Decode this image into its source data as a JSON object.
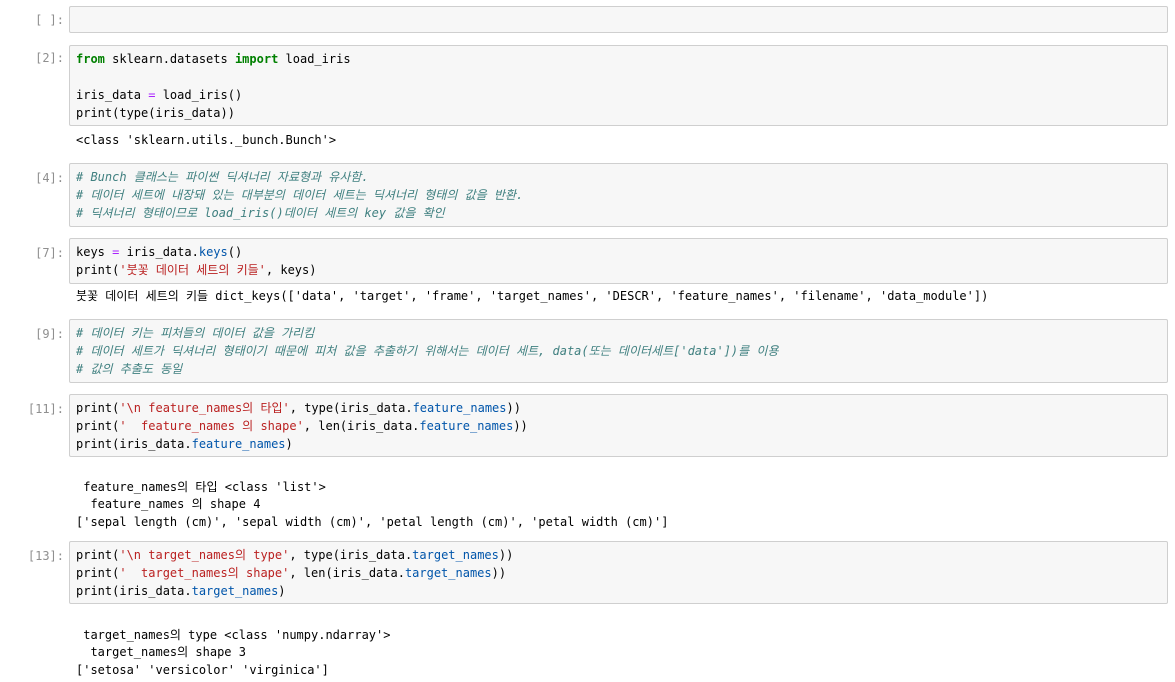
{
  "cells": [
    {
      "prompt": "[ ]:",
      "lines": []
    },
    {
      "prompt": "[2]:",
      "lines": [
        [
          "from",
          " sklearn.datasets ",
          "import",
          " load_iris"
        ],
        [],
        [
          "iris_data ",
          "=",
          " load_iris()"
        ],
        [
          "print(type(iris_data))"
        ]
      ],
      "output": [
        "<class 'sklearn.utils._bunch.Bunch'>"
      ]
    },
    {
      "prompt": "[4]:",
      "lines": [
        [
          "# Bunch 클래스는 파이썬 딕셔너리 자료형과 유사함."
        ],
        [
          "# 데이터 세트에 내장돼 있는 대부분의 데이터 세트는 딕셔너리 형태의 값을 반환."
        ],
        [
          "# 딕셔너리 형태이므로 load_iris()데이터 세트의 key 값을 확인"
        ]
      ]
    },
    {
      "prompt": "[7]:",
      "lines": [
        [
          "keys ",
          "=",
          " iris_data.",
          "keys",
          "()"
        ],
        [
          "print(",
          "'붓꽃 데이터 세트의 키들'",
          ", keys)"
        ]
      ],
      "output": [
        "붓꽃 데이터 세트의 키들 dict_keys(['data', 'target', 'frame', 'target_names', 'DESCR', 'feature_names', 'filename', 'data_module'])"
      ]
    },
    {
      "prompt": "[9]:",
      "lines": [
        [
          "# 데이터 키는 피처들의 데이터 값을 가리킴"
        ],
        [
          "# 데이터 세트가 딕셔너리 형태이기 때문에 피처 값을 추출하기 위해서는 데이터 세트, data(또는 데이터세트['data'])를 이용"
        ],
        [
          "# 값의 추출도 동일"
        ]
      ]
    },
    {
      "prompt": "[11]:",
      "lines": [
        [
          "print(",
          "'\\n feature_names의 타입'",
          ", type(iris_data.",
          "feature_names",
          "))"
        ],
        [
          "print(",
          "'  feature_names 의 shape'",
          ", len(iris_data.",
          "feature_names",
          "))"
        ],
        [
          "print(iris_data.",
          "feature_names",
          ")"
        ]
      ],
      "output": [
        "",
        " feature_names의 타입 <class 'list'>",
        "  feature_names 의 shape 4",
        "['sepal length (cm)', 'sepal width (cm)', 'petal length (cm)', 'petal width (cm)']"
      ]
    },
    {
      "prompt": "[13]:",
      "lines": [
        [
          "print(",
          "'\\n target_names의 type'",
          ", type(iris_data.",
          "target_names",
          "))"
        ],
        [
          "print(",
          "'  target_names의 shape'",
          ", len(iris_data.",
          "target_names",
          "))"
        ],
        [
          "print(iris_data.",
          "target_names",
          ")"
        ]
      ],
      "output": [
        "",
        " target_names의 type <class 'numpy.ndarray'>",
        "  target_names의 shape 3",
        "['setosa' 'versicolor' 'virginica']"
      ]
    }
  ]
}
